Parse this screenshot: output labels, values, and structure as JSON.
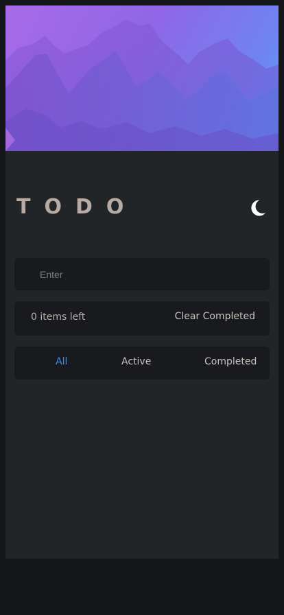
{
  "header": {
    "title": "TODO",
    "theme_toggle_icon": "moon-icon"
  },
  "new_todo": {
    "placeholder": "Enter",
    "value": ""
  },
  "status": {
    "items_left": "0 items left",
    "clear_label": "Clear Completed"
  },
  "filters": {
    "all": "All",
    "active": "Active",
    "completed": "Completed",
    "selected": "All"
  },
  "colors": {
    "accent": "#3c8ee8",
    "background": "#212528",
    "card": "#181a1d",
    "title": "#b7aba3"
  }
}
